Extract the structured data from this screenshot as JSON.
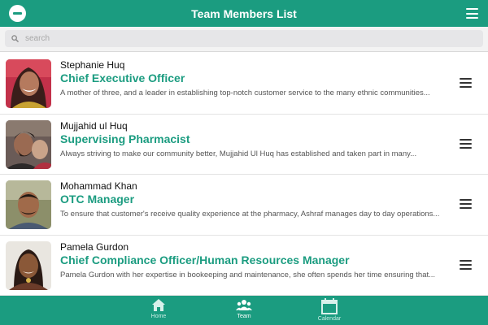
{
  "header": {
    "title": "Team Members List"
  },
  "search": {
    "placeholder": "search"
  },
  "members": [
    {
      "name": "Stephanie Huq",
      "role": "Chief Executive Officer",
      "description": "A mother of three, and a leader in establishing top-notch customer service to the many ethnic communities..."
    },
    {
      "name": "Mujjahid ul Huq",
      "role": "Supervising Pharmacist",
      "description": "Always striving to make our community better, Mujjahid Ul Huq has established and taken part in many..."
    },
    {
      "name": "Mohammad Khan",
      "role": "OTC Manager",
      "description": "To ensure that customer's receive quality experience at the pharmacy, Ashraf manages day to day operations..."
    },
    {
      "name": "Pamela Gurdon",
      "role": "Chief Compliance Officer/Human Resources Manager",
      "description": "Pamela Gurdon with her expertise in bookeeping and maintenance, she often spends her time ensuring that..."
    }
  ],
  "tabs": [
    {
      "label": "Home",
      "icon": "home-icon"
    },
    {
      "label": "Team",
      "icon": "team-icon"
    },
    {
      "label": "Calendar",
      "icon": "calendar-icon"
    }
  ],
  "colors": {
    "primary": "#1b9c80",
    "role_text": "#1b9c80",
    "search_bg": "#e6e6e8"
  }
}
